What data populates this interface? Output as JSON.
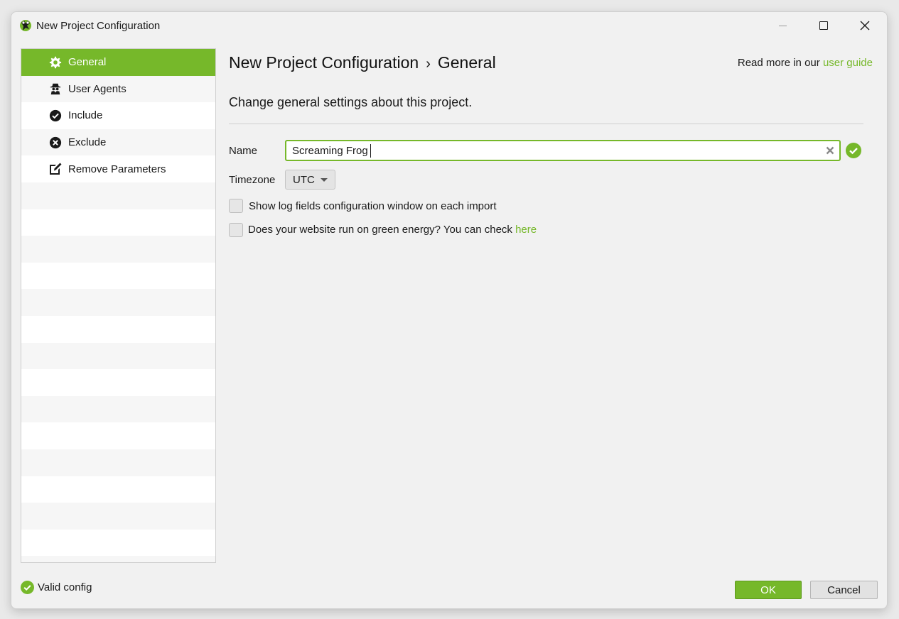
{
  "window": {
    "title": "New Project Configuration"
  },
  "sidebar": {
    "items": [
      {
        "label": "General",
        "icon": "gear-icon",
        "active": true
      },
      {
        "label": "User Agents",
        "icon": "spy-icon",
        "active": false
      },
      {
        "label": "Include",
        "icon": "check-circle-icon",
        "active": false
      },
      {
        "label": "Exclude",
        "icon": "x-circle-icon",
        "active": false
      },
      {
        "label": "Remove Parameters",
        "icon": "edit-icon",
        "active": false
      }
    ]
  },
  "header": {
    "crumb_root": "New Project Configuration",
    "crumb_sep": "›",
    "crumb_current": "General",
    "readmore_text": "Read more in our",
    "readmore_link": "user guide"
  },
  "main": {
    "description": "Change general settings about this project.",
    "name_label": "Name",
    "name_value": "Screaming Frog",
    "timezone_label": "Timezone",
    "timezone_value": "UTC",
    "checkbox1_label": "Show log fields configuration window on each import",
    "checkbox1_checked": false,
    "checkbox2_label": "Does your website run on green energy? You can check",
    "checkbox2_link": "here",
    "checkbox2_checked": false
  },
  "footer": {
    "status": "Valid config",
    "ok_label": "OK",
    "cancel_label": "Cancel"
  },
  "colors": {
    "accent": "#76b82a"
  }
}
